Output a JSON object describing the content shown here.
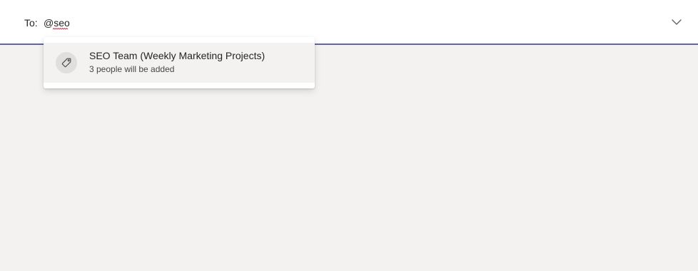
{
  "recipient": {
    "label": "To:",
    "value": "@seo"
  },
  "icons": {
    "expand": "chevron-down-icon",
    "tag": "tag-icon"
  },
  "suggestions": [
    {
      "title": "SEO Team (Weekly Marketing Projects)",
      "subtitle": "3 people will be added"
    }
  ],
  "colors": {
    "accent": "#6264a7",
    "background": "#f3f2f1",
    "surface": "#ffffff",
    "spellcheck": "#c4314b"
  }
}
